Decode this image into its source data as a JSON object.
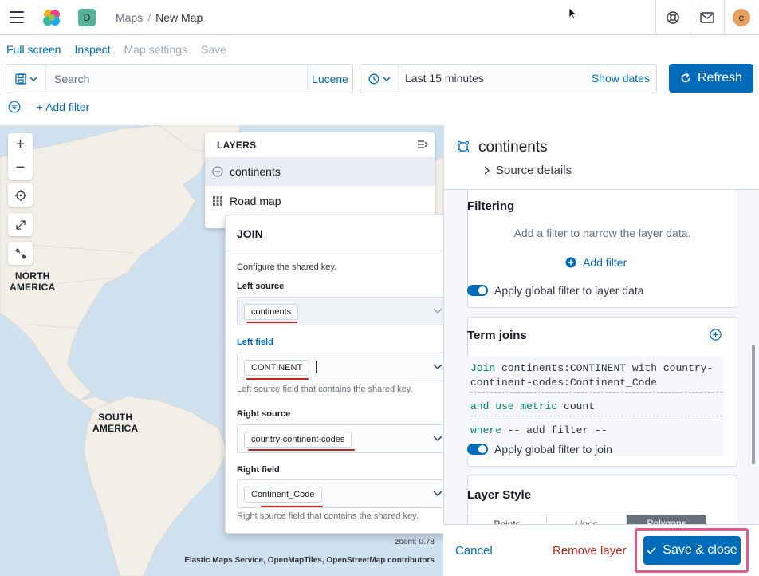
{
  "header": {
    "space_initial": "D",
    "breadcrumbs": [
      "Maps",
      "New Map"
    ],
    "avatar_initial": "e"
  },
  "topnav": {
    "full_screen": "Full screen",
    "inspect": "Inspect",
    "map_settings": "Map settings",
    "save": "Save"
  },
  "query": {
    "placeholder": "Search",
    "language": "Lucene"
  },
  "date": {
    "range": "Last 15 minutes",
    "show_dates": "Show dates"
  },
  "refresh_label": "Refresh",
  "add_filter_label": "+ Add filter",
  "map": {
    "labels": {
      "north_america": "NORTH\nAMERICA",
      "south_america": "SOUTH\nAMERICA"
    },
    "zoom_text": "zoom: 0.78",
    "attribution": "Elastic Maps Service, OpenMapTiles, OpenStreetMap contributors"
  },
  "layers": {
    "title": "LAYERS",
    "items": [
      {
        "label": "continents",
        "icon": "minus-circle-icon"
      },
      {
        "label": "Road map",
        "icon": "grid-icon"
      }
    ]
  },
  "join_popover": {
    "title": "JOIN",
    "description": "Configure the shared key.",
    "left_source_label": "Left source",
    "left_source_value": "continents",
    "left_field_label": "Left field",
    "left_field_value": "CONTINENT",
    "left_field_help": "Left source field that contains the shared key.",
    "right_source_label": "Right source",
    "right_source_value": "country-continent-codes",
    "right_field_label": "Right field",
    "right_field_value": "Continent_Code",
    "right_field_help": "Right source field that contains the shared key."
  },
  "layer_panel": {
    "title": "continents",
    "source_details": "Source details",
    "filtering": {
      "title": "Filtering",
      "help": "Add a filter to narrow the layer data.",
      "add_filter": "Add filter",
      "apply_global": "Apply global filter to layer data"
    },
    "term_joins": {
      "title": "Term joins",
      "join_kw": "Join",
      "join_line1": "continents:CONTINENT with country-",
      "join_line2": "continent-codes:Continent_Code",
      "metric_kw": "and use metric",
      "metric_value": "count",
      "where_kw": "where",
      "where_value": "-- add filter --",
      "apply_global": "Apply global filter to join"
    },
    "layer_style": {
      "title": "Layer Style",
      "tabs": [
        "Points",
        "Lines",
        "Polygons"
      ]
    }
  },
  "footer": {
    "cancel": "Cancel",
    "remove": "Remove layer",
    "save_close": "Save & close"
  },
  "colors": {
    "primary": "#006bb8",
    "danger": "#bd271e",
    "highlight_outline": "#e05c8a",
    "map_water": "#cfe1ef",
    "map_land": "#f2efe9"
  }
}
